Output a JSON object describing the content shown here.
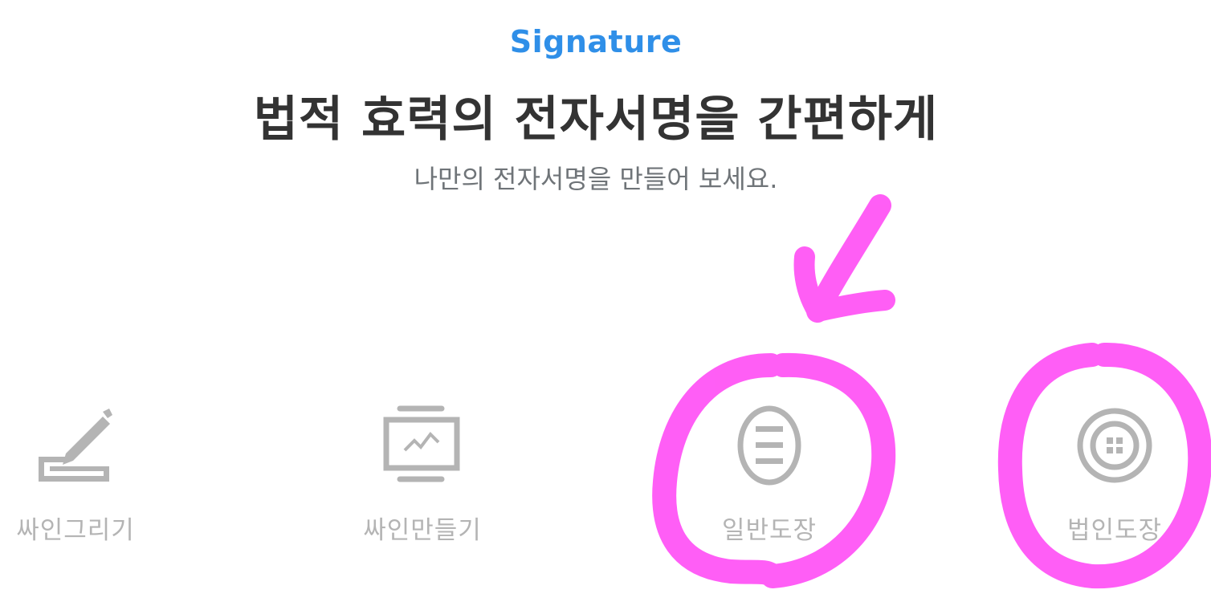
{
  "header": {
    "eyebrow": "Signature",
    "title": "법적 효력의 전자서명을 간편하게",
    "subtitle": "나만의 전자서명을 만들어 보세요."
  },
  "options": [
    {
      "label": "싸인그리기",
      "icon": "pen-draw-icon"
    },
    {
      "label": "싸인만들기",
      "icon": "monitor-signature-icon"
    },
    {
      "label": "일반도장",
      "icon": "personal-stamp-icon"
    },
    {
      "label": "법인도장",
      "icon": "corporate-stamp-icon"
    }
  ],
  "colors": {
    "accent": "#2f8fe8",
    "title": "#333333",
    "subtitle": "#6f7478",
    "icon": "#b4b4b4",
    "annotation": "#ff4df5"
  }
}
